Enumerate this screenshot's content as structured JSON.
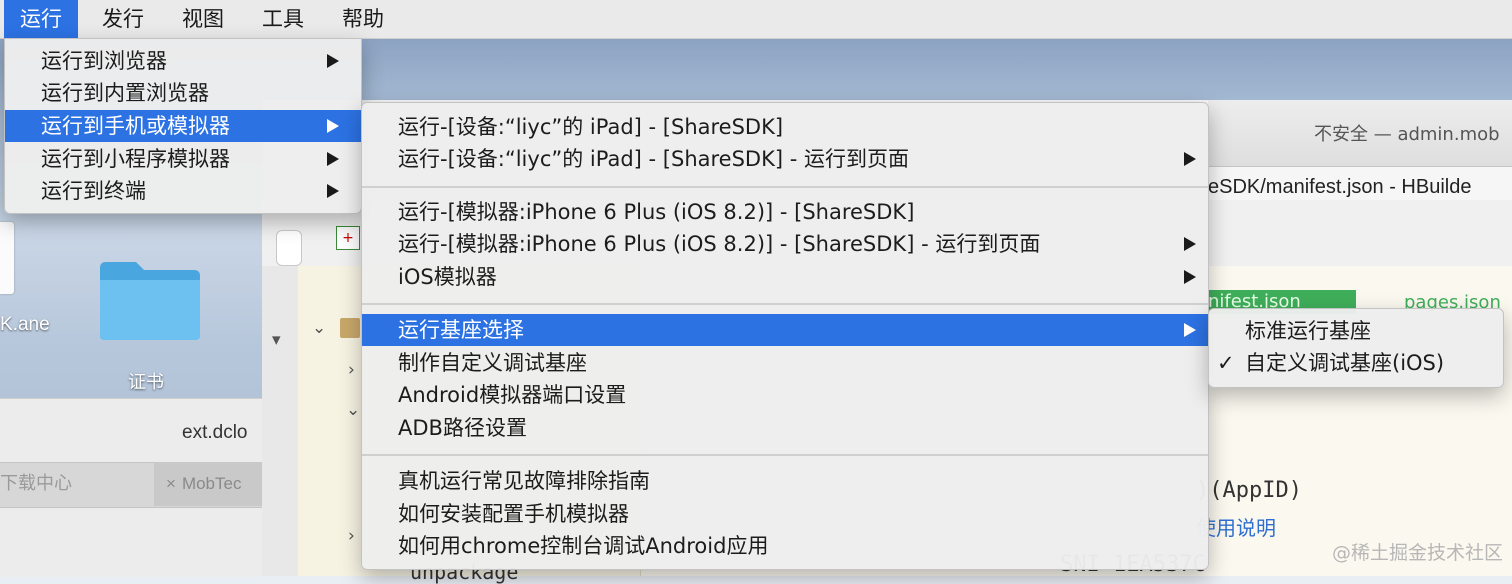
{
  "menubar": {
    "items": [
      {
        "label": "运行",
        "active": true
      },
      {
        "label": "发行"
      },
      {
        "label": "视图"
      },
      {
        "label": "工具"
      },
      {
        "label": "帮助"
      }
    ]
  },
  "run_menu": {
    "items": [
      {
        "label": "运行到浏览器",
        "submenu": true
      },
      {
        "label": "运行到内置浏览器",
        "submenu": false
      },
      {
        "label": "运行到手机或模拟器",
        "submenu": true,
        "highlighted": true
      },
      {
        "label": "运行到小程序模拟器",
        "submenu": true
      },
      {
        "label": "运行到终端",
        "submenu": true
      }
    ]
  },
  "device_menu": {
    "items": [
      {
        "label": "运行-[设备:“liyc”的 iPad] - [ShareSDK]"
      },
      {
        "label": "运行-[设备:“liyc”的 iPad] - [ShareSDK] - 运行到页面",
        "submenu": true
      },
      {
        "label": "运行-[模拟器:iPhone 6 Plus (iOS 8.2)] - [ShareSDK]"
      },
      {
        "label": "运行-[模拟器:iPhone 6 Plus (iOS 8.2)] - [ShareSDK] - 运行到页面",
        "submenu": true
      },
      {
        "label": "iOS模拟器",
        "submenu": true
      },
      {
        "label": "运行基座选择",
        "submenu": true,
        "highlighted": true
      },
      {
        "label": "制作自定义调试基座"
      },
      {
        "label": "Android模拟器端口设置"
      },
      {
        "label": "ADB路径设置"
      },
      {
        "label": "真机运行常见故障排除指南"
      },
      {
        "label": "如何安装配置手机模拟器"
      },
      {
        "label": "如何用chrome控制台调试Android应用"
      }
    ]
  },
  "base_menu": {
    "items": [
      {
        "label": "标准运行基座",
        "checked": false
      },
      {
        "label": "自定义调试基座(iOS)",
        "checked": true
      }
    ],
    "check_mark": "✓"
  },
  "desktop": {
    "file_label": "K.ane",
    "folder_label": "证书",
    "folder_color": "#5fb6ea"
  },
  "browser": {
    "url_text": "ext.dclo",
    "tab_1": "下载中心",
    "tab_2": "MobTec",
    "tab_close": "×"
  },
  "hbuilder": {
    "address_text": "不安全 — admin.mob",
    "path_text": "eSDK/manifest.json - HBuilde",
    "tab_manifest": "nifest.json",
    "tab_pages": "pages.json",
    "appid_text": ")(AppID)",
    "usage_link": "使用说明",
    "code_fragment": "SNI   1EA537C",
    "tree_bottom": "unpackage",
    "accent_green": "#3fae5a"
  },
  "watermark": "@稀土掘金技术社区"
}
